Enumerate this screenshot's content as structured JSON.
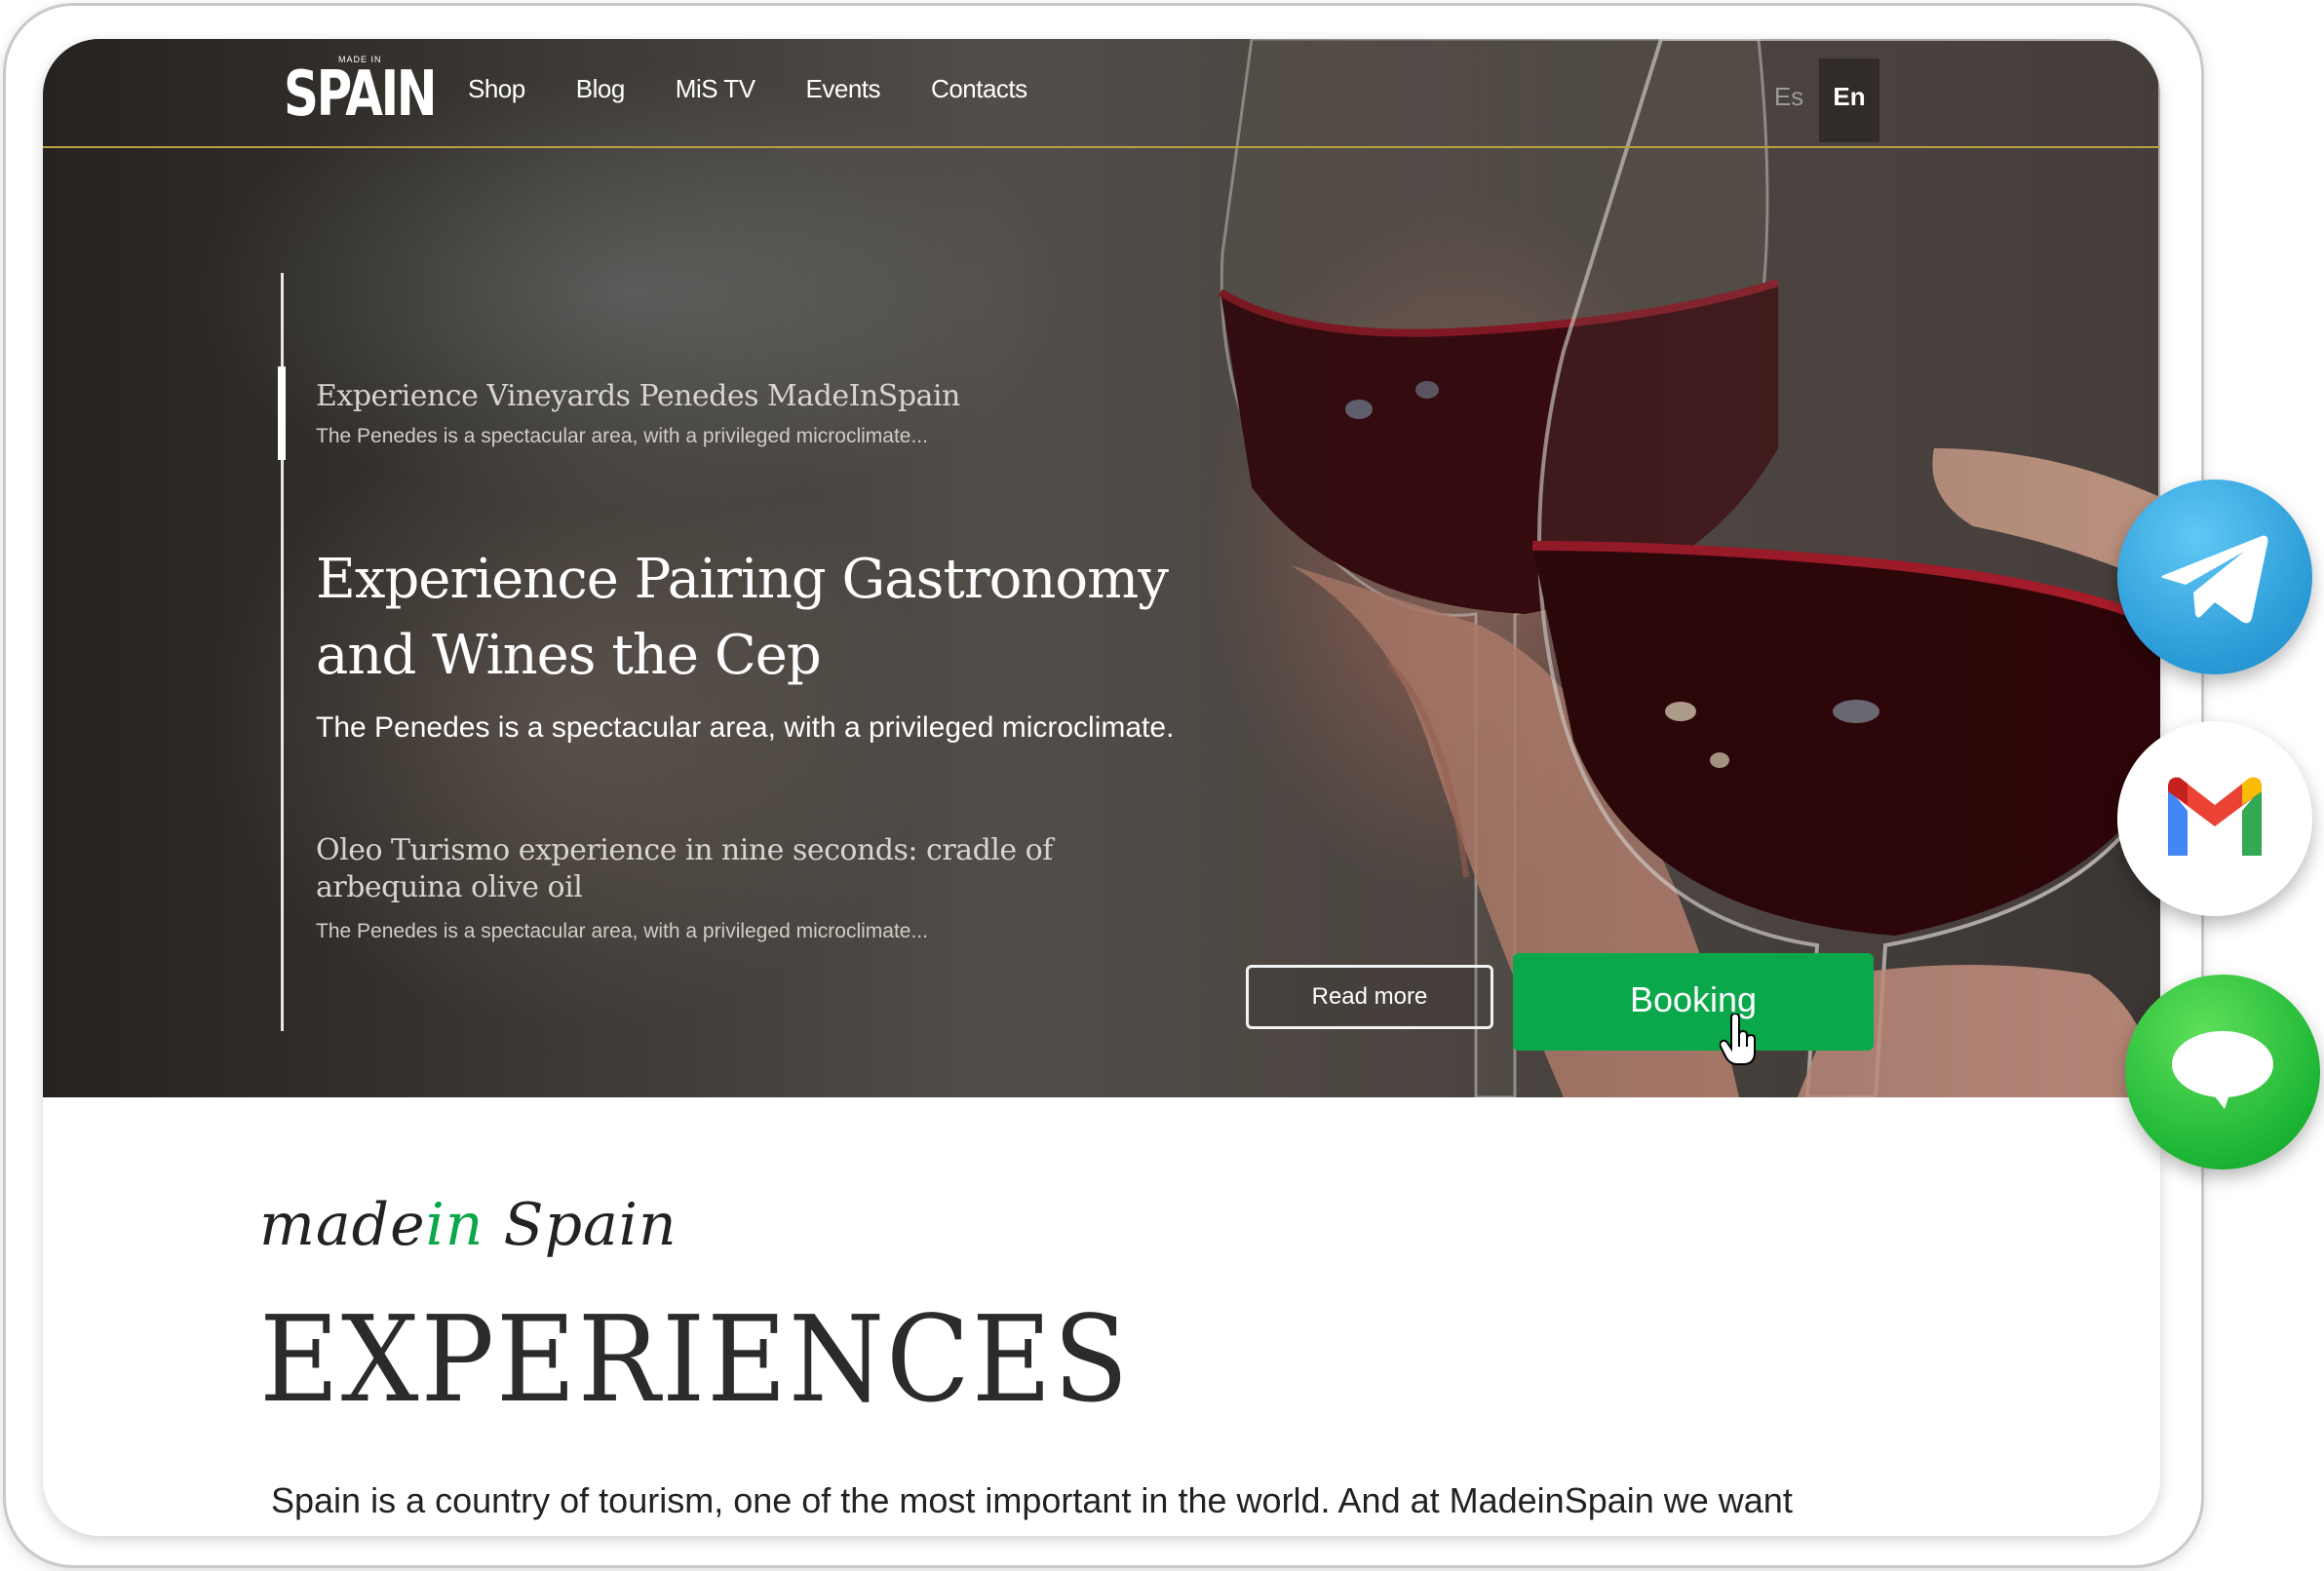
{
  "nav": {
    "logo": {
      "word": "SPAIN",
      "tag": "MADE IN"
    },
    "links": [
      "Shop",
      "Blog",
      "MiS TV",
      "Events",
      "Contacts"
    ],
    "languages": [
      "Es",
      "En"
    ],
    "active_language": "En"
  },
  "slider": {
    "items": [
      {
        "title": "Experience Vineyards Penedes MadeInSpain",
        "subtitle": "The Penedes is a spectacular area, with a privileged microclimate..."
      },
      {
        "title": "Experience Pairing Gastronomy and Wines the Cep",
        "subtitle": "The Penedes is a spectacular area, with a privileged microclimate."
      },
      {
        "title": "Oleo Turismo experience in nine seconds: cradle of arbequina olive oil",
        "subtitle": "The Penedes is a spectacular area, with a privileged microclimate..."
      }
    ],
    "read_more": "Read more",
    "booking": "Booking"
  },
  "section": {
    "script_made": "madein",
    "script_spain": "Spain",
    "heading": "EXPERIENCES",
    "body": "Spain is a country of tourism, one of the most important in the world. And at MadeinSpain we want"
  },
  "floating": [
    {
      "name": "telegram-icon",
      "color": "#2a9ad6"
    },
    {
      "name": "gmail-icon",
      "color": "#ffffff"
    },
    {
      "name": "message-icon",
      "color": "#1db535"
    }
  ],
  "colors": {
    "accent": "#0aa84a",
    "nav_border": "#b9a045"
  }
}
